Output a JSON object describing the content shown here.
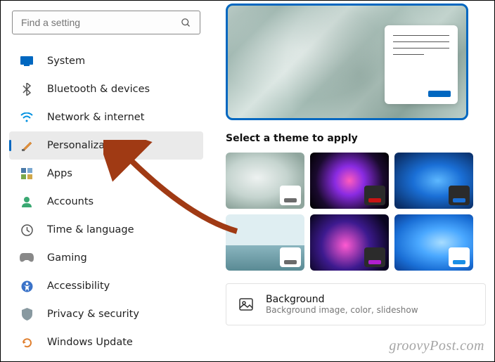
{
  "search": {
    "placeholder": "Find a setting"
  },
  "nav": {
    "items": [
      {
        "label": "System"
      },
      {
        "label": "Bluetooth & devices"
      },
      {
        "label": "Network & internet"
      },
      {
        "label": "Personalization"
      },
      {
        "label": "Apps"
      },
      {
        "label": "Accounts"
      },
      {
        "label": "Time & language"
      },
      {
        "label": "Gaming"
      },
      {
        "label": "Accessibility"
      },
      {
        "label": "Privacy & security"
      },
      {
        "label": "Windows Update"
      }
    ]
  },
  "content": {
    "theme_heading": "Select a theme to apply",
    "themes": [
      {
        "accent": "#6b6b6b",
        "mini_dark": false
      },
      {
        "accent": "#c81414",
        "mini_dark": true
      },
      {
        "accent": "#1a6fd6",
        "mini_dark": true
      },
      {
        "accent": "#6b6b6b",
        "mini_dark": false
      },
      {
        "accent": "#b01fcf",
        "mini_dark": true
      },
      {
        "accent": "#1a8fe6",
        "mini_dark": false
      }
    ],
    "rows": {
      "background": {
        "title": "Background",
        "subtitle": "Background image, color, slideshow"
      }
    }
  },
  "watermark": "groovyPost.com"
}
